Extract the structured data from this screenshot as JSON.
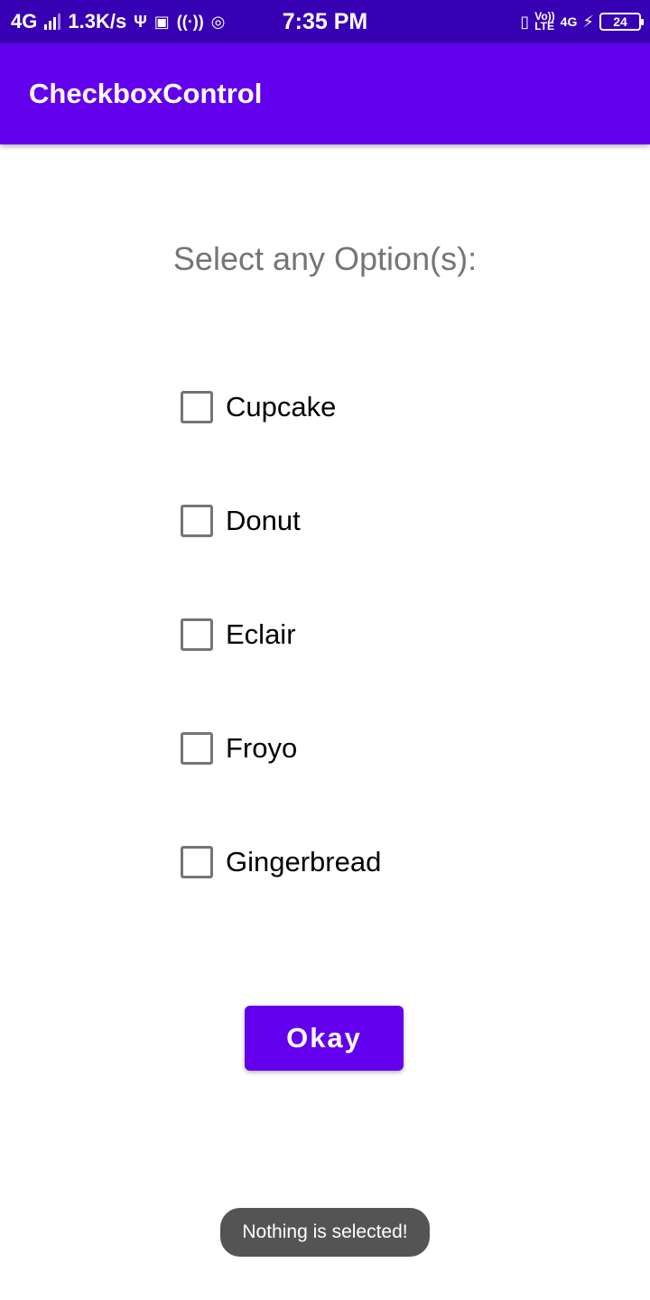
{
  "status_bar": {
    "network": "4G",
    "speed": "1.3K/s",
    "time": "7:35 PM",
    "volte": "Vo))",
    "lte": "LTE",
    "network_right": "4G",
    "battery": "24"
  },
  "app_bar": {
    "title": "CheckboxControl"
  },
  "main": {
    "prompt": "Select any Option(s):",
    "options": [
      {
        "label": "Cupcake",
        "checked": false
      },
      {
        "label": "Donut",
        "checked": false
      },
      {
        "label": "Eclair",
        "checked": false
      },
      {
        "label": "Froyo",
        "checked": false
      },
      {
        "label": "Gingerbread",
        "checked": false
      }
    ],
    "okay_label": "Okay"
  },
  "toast": {
    "message": "Nothing is selected!"
  },
  "colors": {
    "status_bar": "#3700b3",
    "primary": "#6200ee",
    "prompt_text": "#757575",
    "checkbox_border": "#757575",
    "toast_bg": "#545454"
  },
  "icons": [
    "signal-icon",
    "usb-icon",
    "notification-icon",
    "hotspot-icon",
    "instagram-icon",
    "vibrate-icon",
    "charging-icon",
    "battery-icon"
  ]
}
